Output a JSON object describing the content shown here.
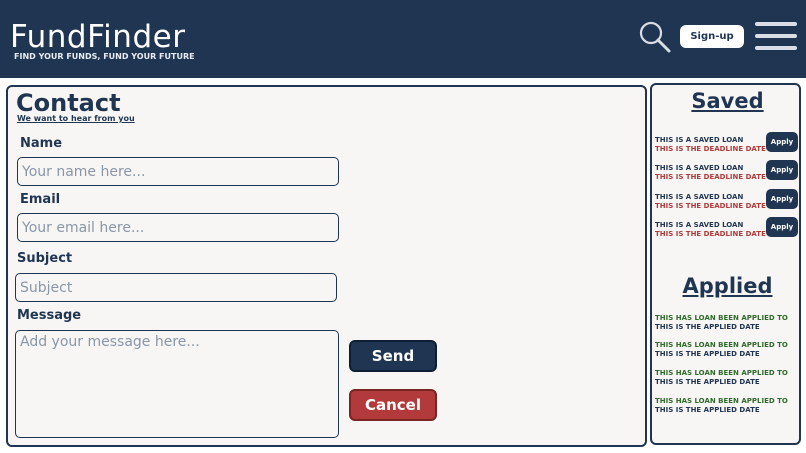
{
  "header": {
    "logo": "FundFinder",
    "tagline": "FIND YOUR FUNDS, FUND YOUR FUTURE",
    "signup_label": "Sign-up",
    "search_icon": "search-icon",
    "menu_icon": "hamburger-menu-icon"
  },
  "contact": {
    "title": "Contact",
    "subtitle": "We want to hear from you",
    "name_label": "Name",
    "name_placeholder": "Your name here...",
    "email_label": "Email",
    "email_placeholder": "Your email here...",
    "subject_label": "Subject",
    "subject_placeholder": "Subject",
    "message_label": "Message",
    "message_placeholder": "Add your message here...",
    "send_label": "Send",
    "cancel_label": "Cancel"
  },
  "saved": {
    "title": "Saved",
    "items": [
      {
        "name": "THIS IS A SAVED LOAN",
        "deadline": "THIS IS THE DEADLINE DATE",
        "button": "Apply"
      },
      {
        "name": "THIS IS A SAVED LOAN",
        "deadline": "THIS IS THE DEADLINE DATE",
        "button": "Apply"
      },
      {
        "name": "THIS IS A SAVED LOAN",
        "deadline": "THIS IS THE DEADLINE DATE",
        "button": "Apply"
      },
      {
        "name": "THIS IS A SAVED LOAN",
        "deadline": "THIS IS THE DEADLINE DATE",
        "button": "Apply"
      }
    ]
  },
  "applied": {
    "title": "Applied",
    "items": [
      {
        "status": "THIS HAS LOAN BEEN APPLIED TO",
        "date": "THIS IS THE APPLIED DATE"
      },
      {
        "status": "THIS HAS LOAN BEEN APPLIED TO",
        "date": "THIS IS THE APPLIED DATE"
      },
      {
        "status": "THIS HAS LOAN BEEN APPLIED TO",
        "date": "THIS IS THE APPLIED DATE"
      },
      {
        "status": "THIS HAS LOAN BEEN APPLIED TO",
        "date": "THIS IS THE APPLIED DATE"
      }
    ]
  },
  "colors": {
    "brand_navy": "#1f3551",
    "cancel_red": "#b23a3a",
    "deadline_red": "#b23a3a",
    "applied_green": "#2f6b2a",
    "panel_bg": "#f8f6f4"
  }
}
